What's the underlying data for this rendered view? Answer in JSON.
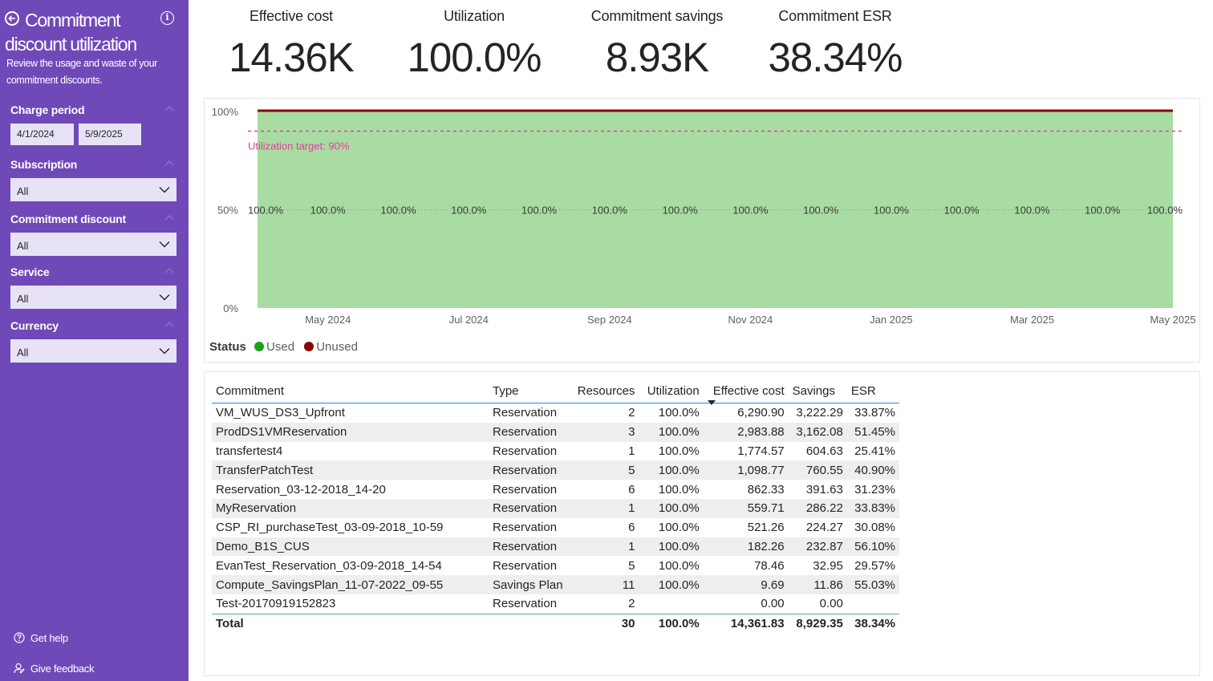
{
  "sidebar": {
    "title": "Commitment discount utilization",
    "subtitle": "Review the usage and waste of your commitment discounts.",
    "filters": {
      "charge_period_label": "Charge period",
      "start_date": "4/1/2024",
      "end_date": "5/9/2025",
      "subscription_label": "Subscription",
      "subscription_value": "All",
      "commitment_label": "Commitment discount",
      "commitment_value": "All",
      "service_label": "Service",
      "service_value": "All",
      "currency_label": "Currency",
      "currency_value": "All"
    },
    "links": {
      "help": "Get help",
      "feedback": "Give feedback"
    },
    "icons": [
      "back-arrow-icon",
      "info-icon",
      "chevron-down-icon",
      "help-icon",
      "feedback-icon"
    ]
  },
  "kpis": [
    {
      "label": "Effective cost",
      "value": "14.36K"
    },
    {
      "label": "Utilization",
      "value": "100.0%"
    },
    {
      "label": "Commitment savings",
      "value": "8.93K"
    },
    {
      "label": "Commitment ESR",
      "value": "38.34%"
    }
  ],
  "chart_data": {
    "type": "area",
    "y_ticks": [
      "100%",
      "50%",
      "0%"
    ],
    "ylim": [
      0,
      100
    ],
    "x_ticks": [
      "May 2024",
      "Jul 2024",
      "Sep 2024",
      "Nov 2024",
      "Jan 2025",
      "Mar 2025",
      "May 2025"
    ],
    "x": [
      "Apr 2024",
      "May 2024",
      "Jun 2024",
      "Jul 2024",
      "Aug 2024",
      "Sep 2024",
      "Oct 2024",
      "Nov 2024",
      "Dec 2024",
      "Jan 2025",
      "Feb 2025",
      "Mar 2025",
      "Apr 2025",
      "May 2025"
    ],
    "series": [
      {
        "name": "Used",
        "color": "#a8dca2",
        "values": [
          100,
          100,
          100,
          100,
          100,
          100,
          100,
          100,
          100,
          100,
          100,
          100,
          100,
          100
        ]
      },
      {
        "name": "Unused",
        "color": "#8b0000",
        "values": [
          0,
          0,
          0,
          0,
          0,
          0,
          0,
          0,
          0,
          0,
          0,
          0,
          0,
          0
        ]
      }
    ],
    "data_labels": [
      "100.0%",
      "100.0%",
      "100.0%",
      "100.0%",
      "100.0%",
      "100.0%",
      "100.0%",
      "100.0%",
      "100.0%",
      "100.0%",
      "100.0%",
      "100.0%",
      "100.0%",
      "100.0%"
    ],
    "target_line": {
      "value": 90,
      "label": "Utilization target: 90%",
      "color": "#e0409a"
    },
    "legend": {
      "title": "Status",
      "items": [
        {
          "name": "Used",
          "color": "#1aa31a"
        },
        {
          "name": "Unused",
          "color": "#8b0000"
        }
      ]
    }
  },
  "table": {
    "columns": [
      "Commitment",
      "Type",
      "Resources",
      "Utilization",
      "Effective cost",
      "Savings",
      "ESR"
    ],
    "rows": [
      [
        "VM_WUS_DS3_Upfront",
        "Reservation",
        "2",
        "100.0%",
        "6,290.90",
        "3,222.29",
        "33.87%"
      ],
      [
        "ProdDS1VMReservation",
        "Reservation",
        "3",
        "100.0%",
        "2,983.88",
        "3,162.08",
        "51.45%"
      ],
      [
        "transfertest4",
        "Reservation",
        "1",
        "100.0%",
        "1,774.57",
        "604.63",
        "25.41%"
      ],
      [
        "TransferPatchTest",
        "Reservation",
        "5",
        "100.0%",
        "1,098.77",
        "760.55",
        "40.90%"
      ],
      [
        "Reservation_03-12-2018_14-20",
        "Reservation",
        "6",
        "100.0%",
        "862.33",
        "391.63",
        "31.23%"
      ],
      [
        "MyReservation",
        "Reservation",
        "1",
        "100.0%",
        "559.71",
        "286.22",
        "33.83%"
      ],
      [
        "CSP_RI_purchaseTest_03-09-2018_10-59",
        "Reservation",
        "6",
        "100.0%",
        "521.26",
        "224.27",
        "30.08%"
      ],
      [
        "Demo_B1S_CUS",
        "Reservation",
        "1",
        "100.0%",
        "182.26",
        "232.87",
        "56.10%"
      ],
      [
        "EvanTest_Reservation_03-09-2018_14-54",
        "Reservation",
        "5",
        "100.0%",
        "78.46",
        "32.95",
        "29.57%"
      ],
      [
        "Compute_SavingsPlan_11-07-2022_09-55",
        "Savings Plan",
        "11",
        "100.0%",
        "9.69",
        "11.86",
        "55.03%"
      ],
      [
        "Test-20170919152823",
        "Reservation",
        "2",
        "",
        "0.00",
        "0.00",
        ""
      ]
    ],
    "total": [
      "Total",
      "",
      "30",
      "100.0%",
      "14,361.83",
      "8,929.35",
      "38.34%"
    ]
  }
}
